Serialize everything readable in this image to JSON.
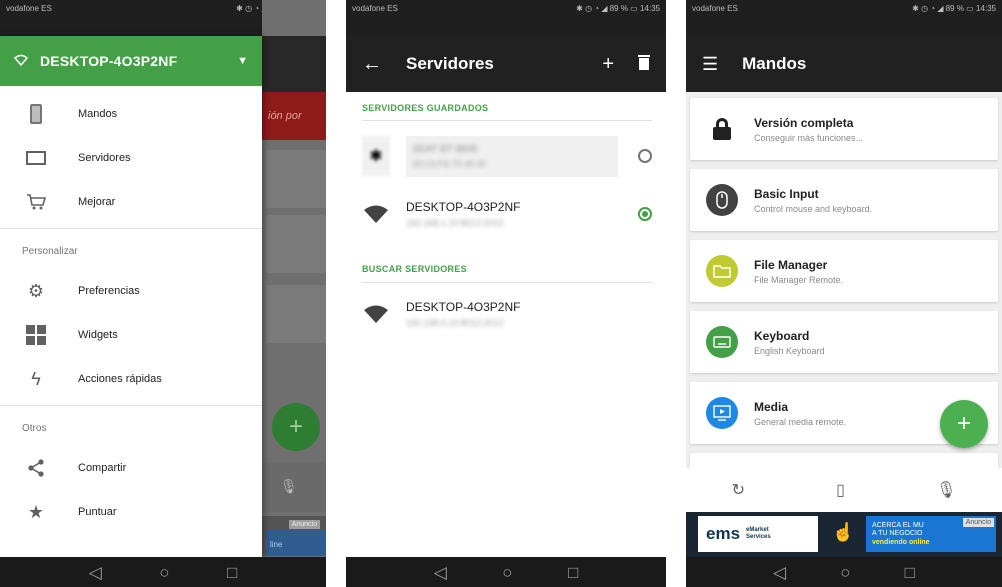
{
  "colors": {
    "green": "#43a047",
    "toolbar": "#212121",
    "status_bar": "#1f1f1f"
  },
  "status": {
    "carrier": "vodafone ES",
    "battery": "89 %",
    "time": "14:35"
  },
  "phone1": {
    "drawer": {
      "header_name": "DESKTOP-4O3P2NF",
      "items_main": [
        {
          "label": "Mandos",
          "icon": "phone-icon"
        },
        {
          "label": "Servidores",
          "icon": "monitor-icon"
        },
        {
          "label": "Mejorar",
          "icon": "cart-icon"
        }
      ],
      "section_personalize": "Personalizar",
      "items_personalize": [
        {
          "label": "Preferencias",
          "icon": "gear-icon"
        },
        {
          "label": "Widgets",
          "icon": "widgets-icon"
        },
        {
          "label": "Acciones rápidas",
          "icon": "lightning-icon"
        }
      ],
      "section_other": "Otros",
      "items_other": [
        {
          "label": "Compartir",
          "icon": "share-icon"
        },
        {
          "label": "Puntuar",
          "icon": "star-icon"
        }
      ]
    },
    "background": {
      "banner_text": "ión por",
      "ad_tag": "Anuncio",
      "ad_text": "line"
    }
  },
  "phone2": {
    "title": "Servidores",
    "section_saved": "SERVIDORES GUARDADOS",
    "section_search": "BUSCAR SERVIDORES",
    "saved": [
      {
        "name": "SEAT BT 8845",
        "sub": "30:C6:F6:75:45:4F",
        "selected": false
      },
      {
        "name": "DESKTOP-4O3P2NF",
        "sub": "192.168.1.10:8012:2012",
        "selected": true
      }
    ],
    "found": [
      {
        "name": "DESKTOP-4O3P2NF",
        "sub": "192.168.0.10:8012:2012"
      }
    ]
  },
  "phone3": {
    "title": "Mandos",
    "remotes": [
      {
        "title": "Versión completa",
        "subtitle": "Conseguir más funciones...",
        "icon": "lock-icon",
        "color": "#ffffff"
      },
      {
        "title": "Basic Input",
        "subtitle": "Control mouse and keyboard.",
        "icon": "mouse-icon",
        "color": "#424242"
      },
      {
        "title": "File Manager",
        "subtitle": "File Manager Remote.",
        "icon": "folder-icon",
        "color": "#c0ca33"
      },
      {
        "title": "Keyboard",
        "subtitle": "English Keyboard",
        "icon": "keyboard-icon",
        "color": "#43a047"
      },
      {
        "title": "Media",
        "subtitle": "General media remote.",
        "icon": "media-icon",
        "color": "#1e88e5"
      }
    ],
    "ad": {
      "brand": "ems",
      "brand_sub_1": "eMarket",
      "brand_sub_2": "Services",
      "line1": "ACERCA EL MU",
      "line2": "A TU NEGOCIO",
      "line3": "vendiendo online",
      "tag": "Anuncio"
    }
  }
}
